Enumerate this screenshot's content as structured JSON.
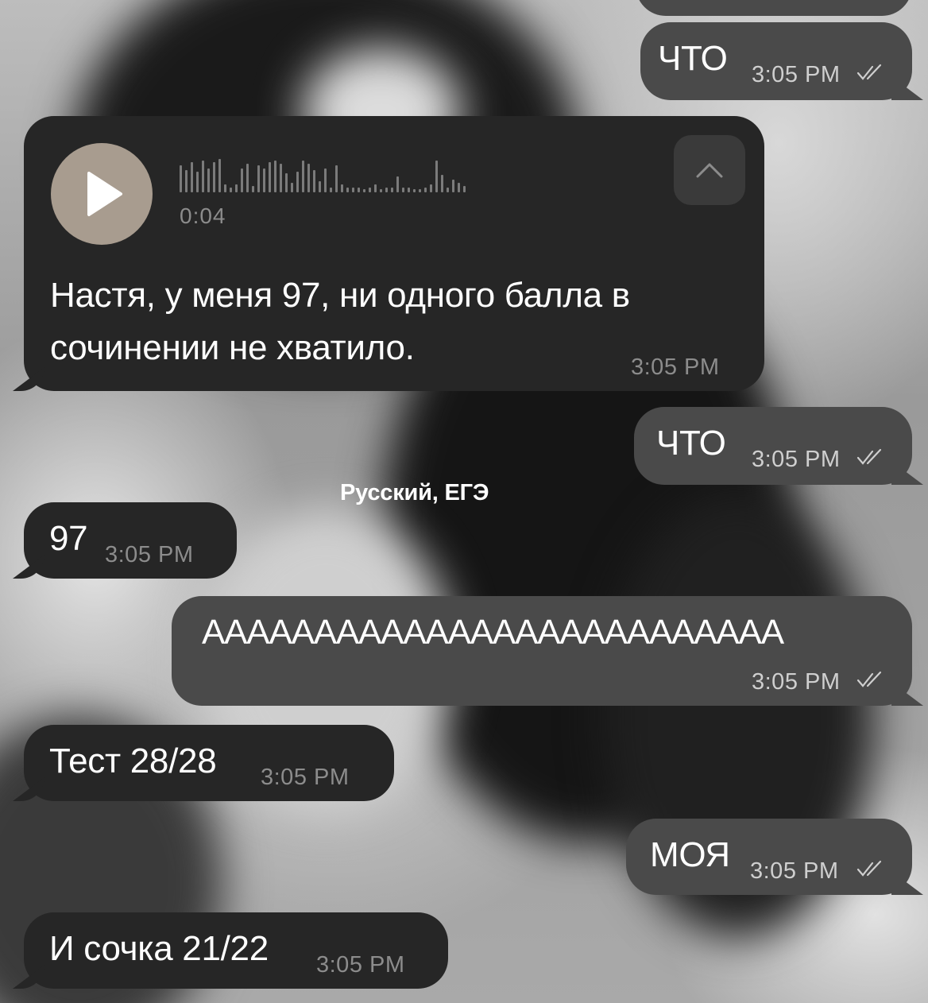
{
  "messages": [
    {
      "id": "m1",
      "direction": "outgoing",
      "text": "ЧТО",
      "time": "3:05 PM",
      "status": "read-double-check"
    },
    {
      "id": "m2",
      "direction": "incoming",
      "type": "voice",
      "duration": "0:04",
      "transcript": [
        "Настя, у меня 97, ни одного балла в",
        "сочинении не хватило."
      ],
      "time": "3:05 PM"
    },
    {
      "id": "m3",
      "direction": "outgoing",
      "text": "ЧТО",
      "time": "3:05 PM",
      "status": "read-double-check"
    },
    {
      "id": "m4",
      "direction": "incoming",
      "text": "97",
      "time": "3:05 PM"
    },
    {
      "id": "m5",
      "direction": "outgoing",
      "text": "АААААААААААААААААААААААААА",
      "time": "3:05 PM",
      "status": "read-double-check"
    },
    {
      "id": "m6",
      "direction": "incoming",
      "text": "Тест 28/28",
      "time": "3:05 PM"
    },
    {
      "id": "m7",
      "direction": "outgoing",
      "text": "МОЯ",
      "time": "3:05 PM",
      "status": "read-double-check"
    },
    {
      "id": "m8",
      "direction": "incoming",
      "text": "И сочка 21/22",
      "time": "3:05 PM"
    }
  ],
  "overlay_caption": "Русский, ЕГЭ",
  "icons": {
    "play": "play-icon",
    "transcribe": "chevron-up-icon",
    "read_status": "double-check-icon"
  },
  "colors": {
    "incoming_bubble": "#262626",
    "outgoing_bubble": "#4a4a4a",
    "play_button": "#a89c8f",
    "text": "#ffffff",
    "timestamp": "#8c8c8c"
  }
}
